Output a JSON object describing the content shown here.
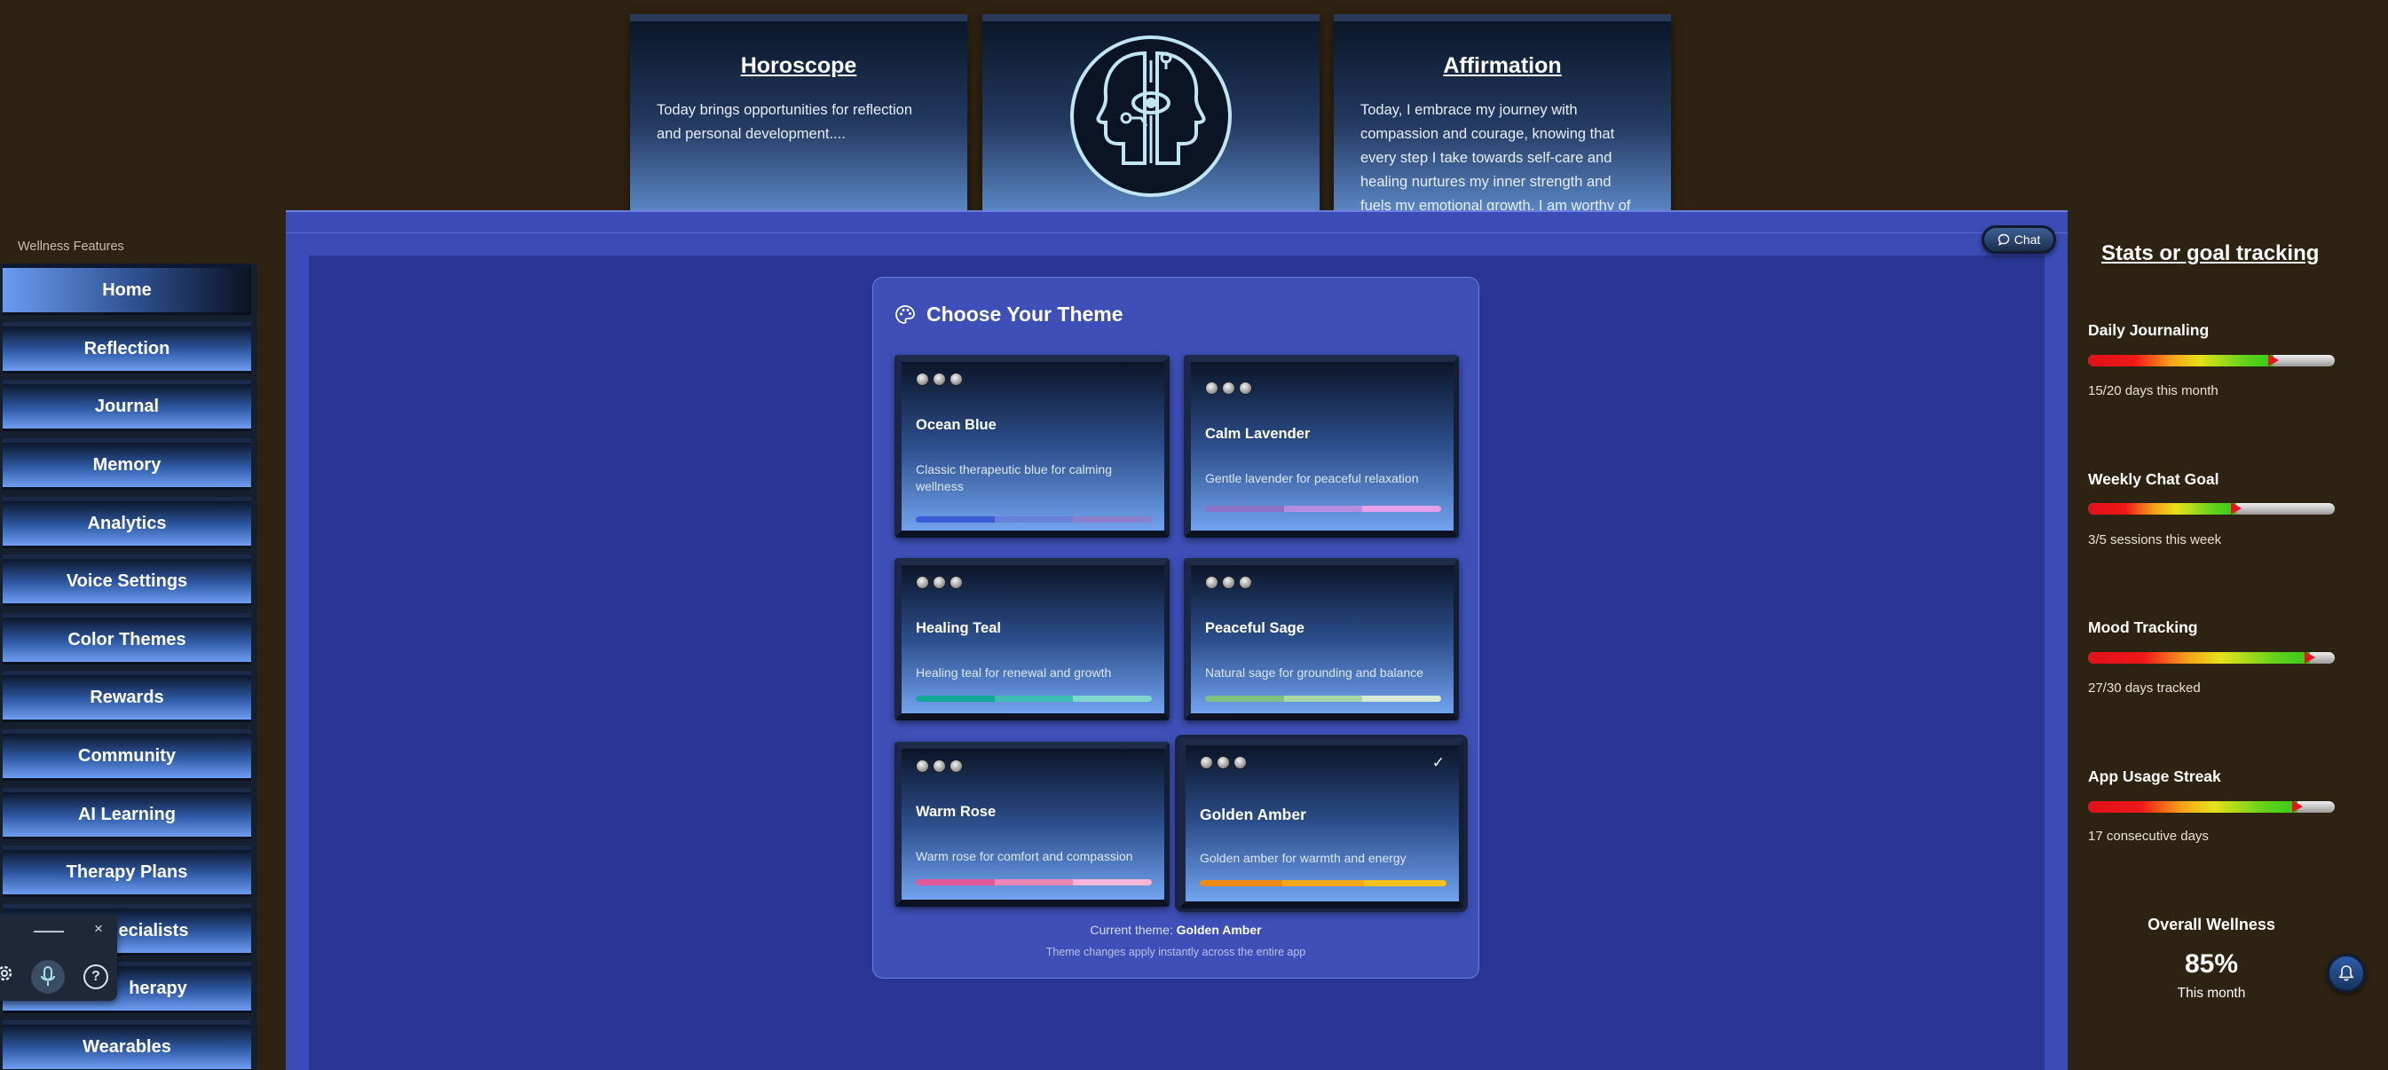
{
  "top_cards": {
    "horoscope": {
      "title": "Horoscope",
      "text": "Today brings opportunities for reflection and personal development...."
    },
    "center_icon": "mind-circuit-head-icon",
    "affirmation": {
      "title": "Affirmation",
      "text": "Today, I embrace my journey with compassion and courage, knowing that every step I take towards self-care and healing nurtures my inner strength and fuels my emotional growth. I am worthy of"
    }
  },
  "sidebar": {
    "title": "Wellness Features",
    "items": [
      {
        "label": "Home",
        "active": true
      },
      {
        "label": "Reflection"
      },
      {
        "label": "Journal"
      },
      {
        "label": "Memory"
      },
      {
        "label": "Analytics"
      },
      {
        "label": "Voice Settings"
      },
      {
        "label": "Color Themes"
      },
      {
        "label": "Rewards"
      },
      {
        "label": "Community"
      },
      {
        "label": "AI Learning"
      },
      {
        "label": "Therapy Plans"
      },
      {
        "label": "ecialists"
      },
      {
        "label": "herapy"
      },
      {
        "label": "Wearables"
      }
    ]
  },
  "voice_widget": {
    "close": "×",
    "help": "?",
    "icons": [
      "gear-icon",
      "microphone-icon",
      "help-icon"
    ]
  },
  "chat_button": {
    "label": "Chat",
    "icon": "chat-bubble-icon"
  },
  "theme_panel": {
    "title": "Choose Your Theme",
    "icon": "palette-icon",
    "themes": [
      {
        "name": "Ocean Blue",
        "description": "Classic therapeutic blue for calming wellness",
        "colors": [
          "#3b5bd6",
          "#6a7fd8",
          "#8a7fc8"
        ]
      },
      {
        "name": "Calm Lavender",
        "description": "Gentle lavender for peaceful relaxation",
        "colors": [
          "#8a72c9",
          "#b68ee0",
          "#e6a0e8"
        ]
      },
      {
        "name": "Healing Teal",
        "description": "Healing teal for renewal and growth",
        "colors": [
          "#14a89a",
          "#3dbdb2",
          "#7fd6cc"
        ]
      },
      {
        "name": "Peaceful Sage",
        "description": "Natural sage for grounding and balance",
        "colors": [
          "#7ec080",
          "#a8d6a4",
          "#d7ebd4"
        ]
      },
      {
        "name": "Warm Rose",
        "description": "Warm rose for comfort and compassion",
        "colors": [
          "#e05a9a",
          "#ec86b8",
          "#f6b6d6"
        ]
      },
      {
        "name": "Golden Amber",
        "description": "Golden amber for warmth and energy",
        "colors": [
          "#f08a10",
          "#f5a81c",
          "#f5c21c"
        ],
        "selected": true
      }
    ],
    "current_label": "Current theme:",
    "current_value": "Golden Amber",
    "note": "Theme changes apply instantly across the entire app"
  },
  "stats": {
    "title": "Stats or goal tracking",
    "items": [
      {
        "label": "Daily Journaling",
        "progress": 0.75,
        "text": "15/20 days this month"
      },
      {
        "label": "Weekly Chat Goal",
        "progress": 0.6,
        "text": "3/5 sessions this week"
      },
      {
        "label": "Mood Tracking",
        "progress": 0.9,
        "text": "27/30 days tracked"
      },
      {
        "label": "App Usage Streak",
        "progress": 0.85,
        "text": "17 consecutive days"
      }
    ],
    "overall": {
      "label": "Overall Wellness",
      "value": "85%",
      "sub": "This month"
    },
    "bell_icon": "bell-icon"
  }
}
